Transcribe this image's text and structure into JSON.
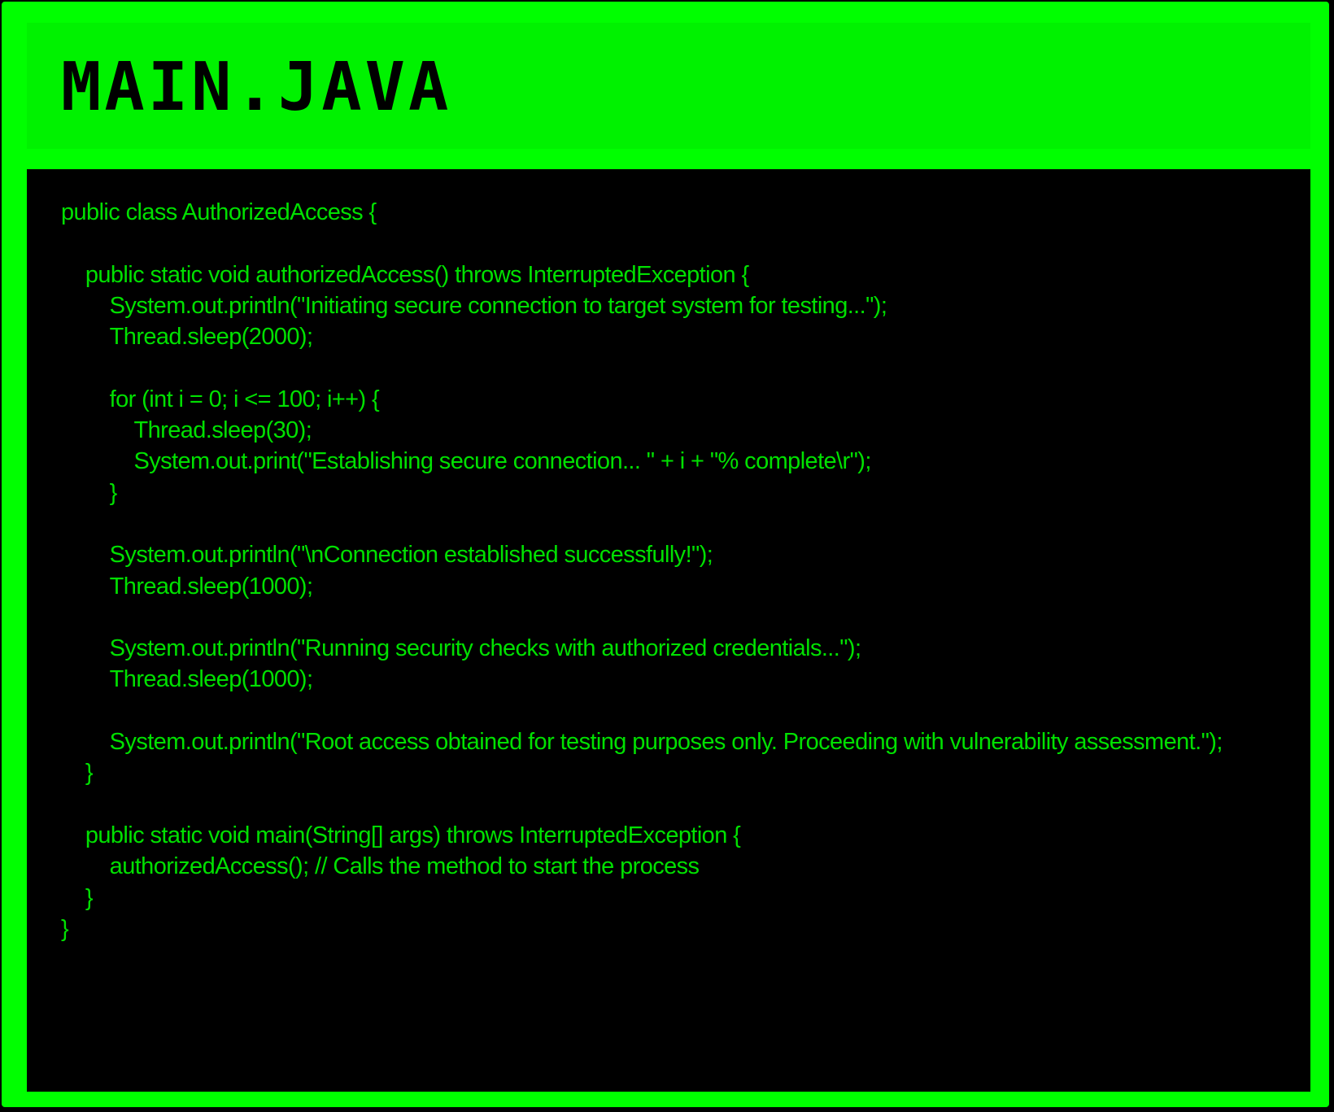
{
  "window": {
    "title": "MAIN.JAVA"
  },
  "editor": {
    "lines": [
      "public class AuthorizedAccess {",
      "",
      "    public static void authorizedAccess() throws InterruptedException {",
      "        System.out.println(\"Initiating secure connection to target system for testing...\");",
      "        Thread.sleep(2000);",
      "",
      "        for (int i = 0; i <= 100; i++) {",
      "            Thread.sleep(30);",
      "            System.out.print(\"Establishing secure connection... \" + i + \"% complete\\r\");",
      "        }",
      "",
      "        System.out.println(\"\\nConnection established successfully!\");",
      "        Thread.sleep(1000);",
      "",
      "        System.out.println(\"Running security checks with authorized credentials...\");",
      "        Thread.sleep(1000);",
      "",
      "        System.out.println(\"Root access obtained for testing purposes only. Proceeding with vulnerability assessment.\");",
      "    }",
      "",
      "    public static void main(String[] args) throws InterruptedException {",
      "        authorizedAccess(); // Calls the method to start the process",
      "    }",
      "}"
    ]
  },
  "colors": {
    "frame": "#00ff00",
    "title_bar": "#00f200",
    "title_text": "#000000",
    "editor_bg": "#000000",
    "code_text": "#00e000"
  }
}
